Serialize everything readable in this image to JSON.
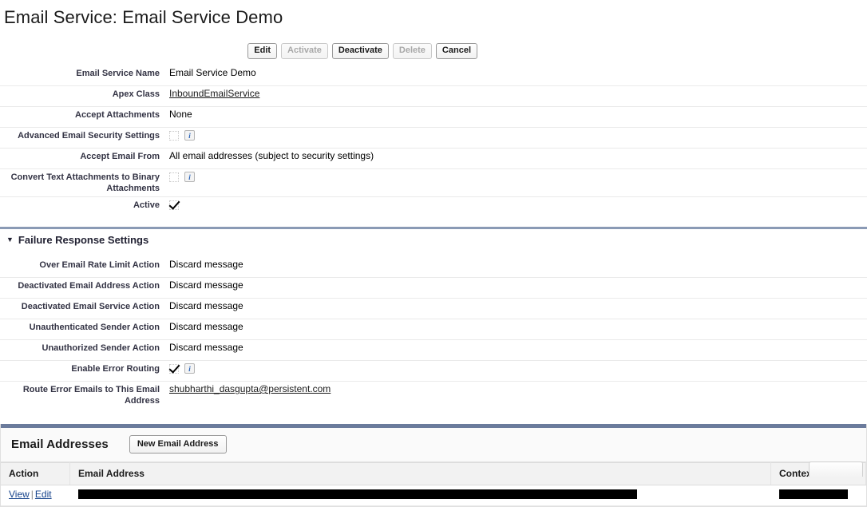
{
  "page": {
    "title": "Email Service: Email Service Demo"
  },
  "toolbar": {
    "buttons": [
      {
        "label": "Edit",
        "disabled": false
      },
      {
        "label": "Activate",
        "disabled": true
      },
      {
        "label": "Deactivate",
        "disabled": false
      },
      {
        "label": "Delete",
        "disabled": true
      },
      {
        "label": "Cancel",
        "disabled": false
      }
    ]
  },
  "details": {
    "rows": [
      {
        "label": "Email Service Name",
        "value": "Email Service Demo",
        "type": "text"
      },
      {
        "label": "Apex Class",
        "value": "InboundEmailService",
        "type": "link"
      },
      {
        "label": "Accept Attachments",
        "value": "None",
        "type": "text"
      },
      {
        "label": "Advanced Email Security Settings",
        "value": "",
        "type": "checkbox-info",
        "checked": false
      },
      {
        "label": "Accept Email From",
        "value": "All email addresses (subject to security settings)",
        "type": "text"
      },
      {
        "label": "Convert Text Attachments to Binary Attachments",
        "value": "",
        "type": "checkbox-info",
        "checked": false
      },
      {
        "label": "Active",
        "value": "",
        "type": "checkbox",
        "checked": true
      }
    ]
  },
  "failure_section": {
    "header": "Failure Response Settings",
    "twisty": "▼",
    "rows": [
      {
        "label": "Over Email Rate Limit Action",
        "value": "Discard message",
        "type": "text"
      },
      {
        "label": "Deactivated Email Address Action",
        "value": "Discard message",
        "type": "text"
      },
      {
        "label": "Deactivated Email Service Action",
        "value": "Discard message",
        "type": "text"
      },
      {
        "label": "Unauthenticated Sender Action",
        "value": "Discard message",
        "type": "text"
      },
      {
        "label": "Unauthorized Sender Action",
        "value": "Discard message",
        "type": "text"
      },
      {
        "label": "Enable Error Routing",
        "value": "",
        "type": "checkbox-info",
        "checked": true
      },
      {
        "label": "Route Error Emails to This Email Address",
        "value": "shubharthi_dasgupta@persistent.com",
        "type": "link"
      }
    ]
  },
  "email_addresses_panel": {
    "title": "Email Addresses",
    "new_button_label": "New Email Address",
    "columns": [
      "Action",
      "Email Address",
      "Context User"
    ],
    "rows": [
      {
        "action_view": "View",
        "action_sep": "|",
        "action_edit": "Edit",
        "email_address": "",
        "email_address_redacted": true,
        "context_user": "",
        "context_user_redacted": true
      }
    ]
  },
  "icons": {
    "info": "i",
    "check": "✓"
  },
  "colors": {
    "link": "#15428b",
    "section_divider": "#8a9ab5",
    "panel_topbar": "#6b7b9c",
    "label_text": "#333344",
    "info_icon": "#2a63b8"
  }
}
